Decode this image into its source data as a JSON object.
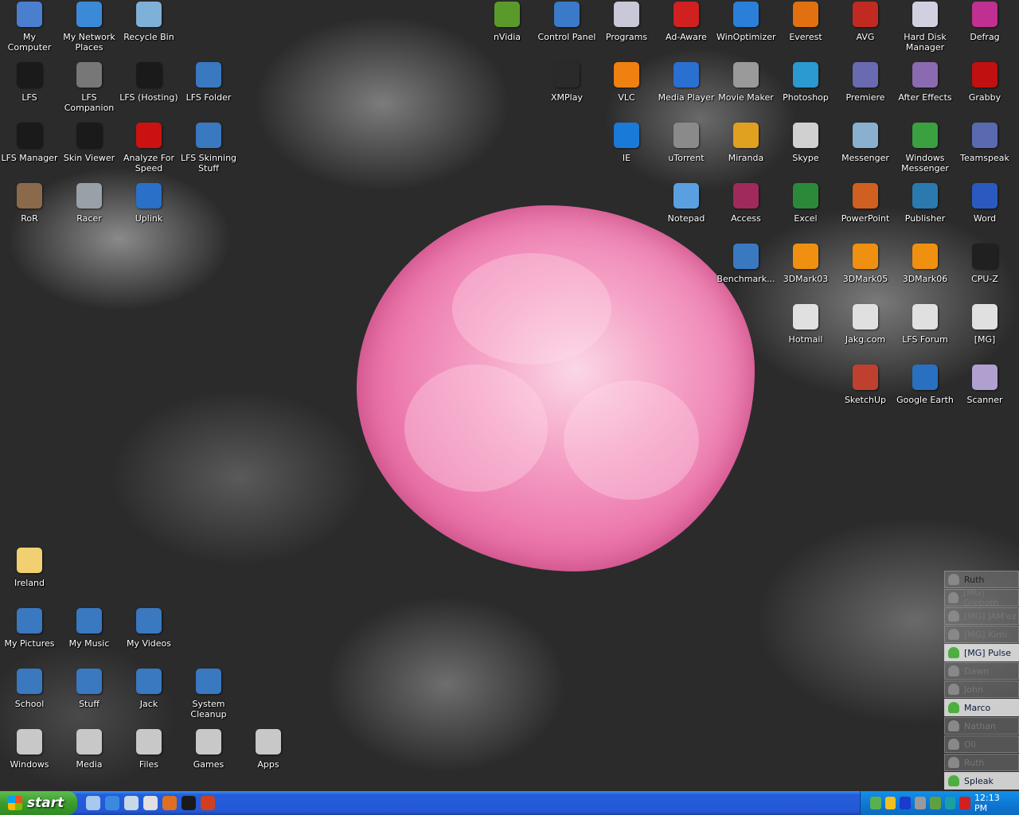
{
  "desktop_icons": [
    {
      "label": "My Computer",
      "color": "#4a7fd0"
    },
    {
      "label": "My Network Places",
      "color": "#3b8ad8"
    },
    {
      "label": "Recycle Bin",
      "color": "#7fb0d8"
    },
    {
      "label": "LFS",
      "color": "#1a1a1a"
    },
    {
      "label": "LFS Companion",
      "color": "#777777"
    },
    {
      "label": "LFS (Hosting)",
      "color": "#1a1a1a"
    },
    {
      "label": "LFS Folder",
      "color": "#3a78c0"
    },
    {
      "label": "LFS Manager",
      "color": "#1a1a1a"
    },
    {
      "label": "Skin Viewer",
      "color": "#1a1a1a"
    },
    {
      "label": "Analyze For Speed",
      "color": "#cc1111"
    },
    {
      "label": "LFS Skinning Stuff",
      "color": "#3a78c0"
    },
    {
      "label": "RoR",
      "color": "#8a6a4a"
    },
    {
      "label": "Racer",
      "color": "#9aa0a8"
    },
    {
      "label": "Uplink",
      "color": "#2a70c8"
    },
    {
      "label": "nVidia",
      "color": "#5a9a2a"
    },
    {
      "label": "Control Panel",
      "color": "#3a7ac8"
    },
    {
      "label": "Programs",
      "color": "#c8c8d8"
    },
    {
      "label": "Ad-Aware",
      "color": "#d02020"
    },
    {
      "label": "WinOptimizer",
      "color": "#2a80d8"
    },
    {
      "label": "Everest",
      "color": "#e07010"
    },
    {
      "label": "AVG",
      "color": "#c02a20"
    },
    {
      "label": "Hard Disk Manager",
      "color": "#d0d0e0"
    },
    {
      "label": "Defrag",
      "color": "#c03090"
    },
    {
      "label": "XMPlay",
      "color": "#2a2a2a"
    },
    {
      "label": "VLC",
      "color": "#f08010"
    },
    {
      "label": "Media Player",
      "color": "#2a70d0"
    },
    {
      "label": "Movie Maker",
      "color": "#9a9a9a"
    },
    {
      "label": "Photoshop",
      "color": "#2a9ad0"
    },
    {
      "label": "Premiere",
      "color": "#6a6ab0"
    },
    {
      "label": "After Effects",
      "color": "#8a6ab0"
    },
    {
      "label": "Grabby",
      "color": "#c01010"
    },
    {
      "label": "IE",
      "color": "#1a7ad8"
    },
    {
      "label": "uTorrent",
      "color": "#8a8a8a"
    },
    {
      "label": "Miranda",
      "color": "#e0a020"
    },
    {
      "label": "Skype",
      "color": "#d0d0d0"
    },
    {
      "label": "Messenger",
      "color": "#8ab0d0"
    },
    {
      "label": "Windows Messenger",
      "color": "#3aa040"
    },
    {
      "label": "Teamspeak",
      "color": "#5a6ab0"
    },
    {
      "label": "Notepad",
      "color": "#5aa0e0"
    },
    {
      "label": "Access",
      "color": "#a02a5a"
    },
    {
      "label": "Excel",
      "color": "#2a8a3a"
    },
    {
      "label": "PowerPoint",
      "color": "#d06020"
    },
    {
      "label": "Publisher",
      "color": "#2a7ab0"
    },
    {
      "label": "Word",
      "color": "#2a5ac0"
    },
    {
      "label": "Benchmark...",
      "color": "#3a78c0"
    },
    {
      "label": "3DMark03",
      "color": "#f09010"
    },
    {
      "label": "3DMark05",
      "color": "#f09010"
    },
    {
      "label": "3DMark06",
      "color": "#f09010"
    },
    {
      "label": "CPU-Z",
      "color": "#202020"
    },
    {
      "label": "Hotmail",
      "color": "#e0e0e0"
    },
    {
      "label": "Jakg.com",
      "color": "#e0e0e0"
    },
    {
      "label": "LFS Forum",
      "color": "#e0e0e0"
    },
    {
      "label": "[MG]",
      "color": "#e0e0e0"
    },
    {
      "label": "SketchUp",
      "color": "#c04030"
    },
    {
      "label": "Google Earth",
      "color": "#2a70c0"
    },
    {
      "label": "Scanner",
      "color": "#b0a0d0"
    },
    {
      "label": "Ireland",
      "color": "#f0d070"
    },
    {
      "label": "My Pictures",
      "color": "#3a78c0"
    },
    {
      "label": "My Music",
      "color": "#3a78c0"
    },
    {
      "label": "My Videos",
      "color": "#3a78c0"
    },
    {
      "label": "School",
      "color": "#3a78c0"
    },
    {
      "label": "Stuff",
      "color": "#3a78c0"
    },
    {
      "label": "Jack",
      "color": "#3a78c0"
    },
    {
      "label": "System Cleanup",
      "color": "#3a78c0"
    },
    {
      "label": "Windows",
      "color": "#c8c8c8"
    },
    {
      "label": "Media",
      "color": "#c8c8c8"
    },
    {
      "label": "Files",
      "color": "#c8c8c8"
    },
    {
      "label": "Games",
      "color": "#c8c8c8"
    },
    {
      "label": "Apps",
      "color": "#c8c8c8"
    }
  ],
  "contacts": [
    {
      "name": "Ruth",
      "status": "offline-dark"
    },
    {
      "name": "[MG] Greboth",
      "status": "offline"
    },
    {
      "name": "[MG] JAM'ez",
      "status": "offline"
    },
    {
      "name": "[MG] Kimi",
      "status": "offline"
    },
    {
      "name": "[MG] Pulse",
      "status": "away"
    },
    {
      "name": "Dawn",
      "status": "offline"
    },
    {
      "name": "John",
      "status": "offline"
    },
    {
      "name": "Marco",
      "status": "away"
    },
    {
      "name": "Nathan",
      "status": "offline"
    },
    {
      "name": "Oli",
      "status": "offline"
    },
    {
      "name": "Ruth",
      "status": "offline"
    },
    {
      "name": "Spleak",
      "status": "online"
    }
  ],
  "taskbar": {
    "start_label": "start",
    "quick_launch": [
      {
        "icon": "show-desktop-icon",
        "color": "#a8c8f0"
      },
      {
        "icon": "internet-explorer-icon",
        "color": "#3a8ae0"
      },
      {
        "icon": "messenger-icon",
        "color": "#c8d8e8"
      },
      {
        "icon": "skype-alien-icon",
        "color": "#e0e0e0"
      },
      {
        "icon": "firefox-icon",
        "color": "#e07020"
      },
      {
        "icon": "lfs-icon",
        "color": "#1a1a1a"
      },
      {
        "icon": "network-icon",
        "color": "#d04020"
      }
    ],
    "tray": [
      {
        "icon": "msn-icon",
        "color": "#5ab050"
      },
      {
        "icon": "aim-icon",
        "color": "#f0c020"
      },
      {
        "icon": "calendar-icon",
        "color": "#1a3ad0"
      },
      {
        "icon": "volume-icon",
        "color": "#9a9a9a"
      },
      {
        "icon": "network-icon",
        "color": "#60a040"
      },
      {
        "icon": "logitech-icon",
        "color": "#1aa0a0"
      },
      {
        "icon": "avg-icon",
        "color": "#d02020"
      }
    ],
    "clock": "12:13 PM"
  }
}
